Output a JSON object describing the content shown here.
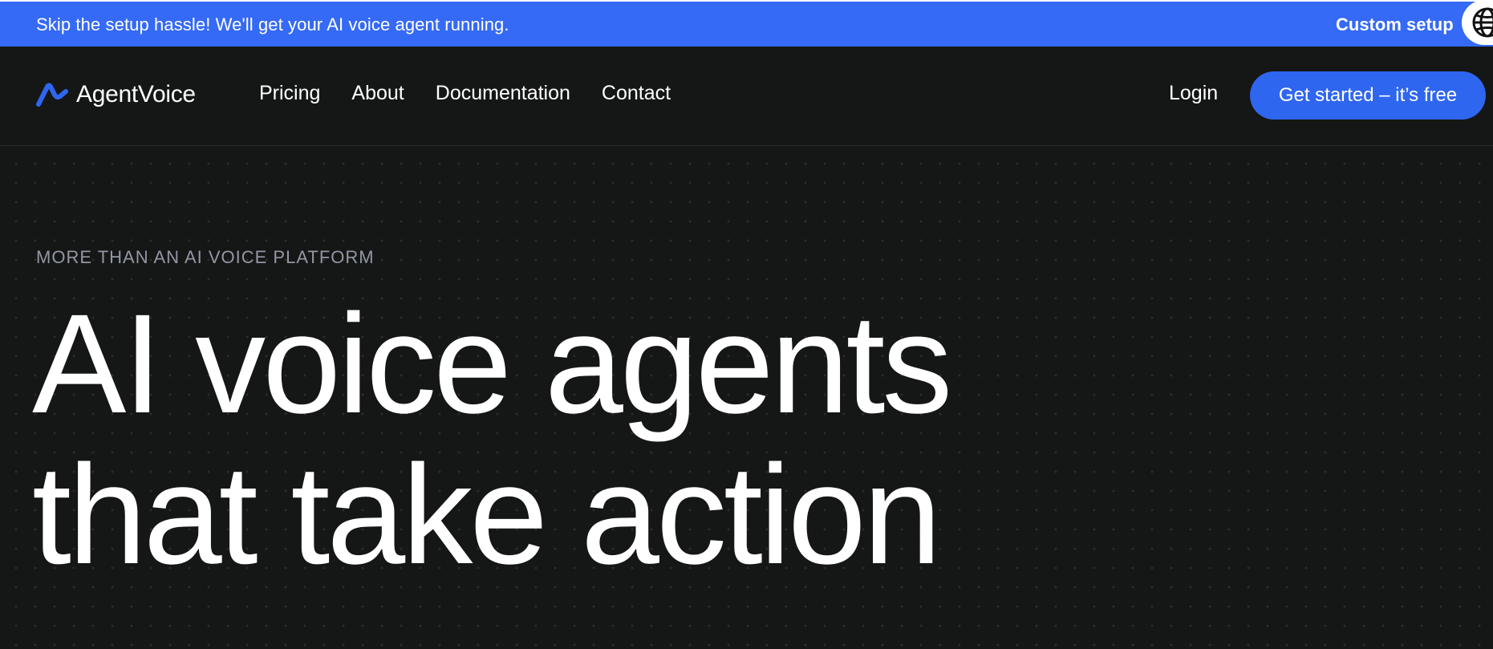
{
  "announcement": {
    "text": "Skip the setup hassle! We'll get your AI voice agent running.",
    "link_label": "Custom setup",
    "background_color": "#356af6",
    "badge_icon": "globe-icon"
  },
  "brand": {
    "name": "AgentVoice",
    "logo_icon": "wave-logo-icon",
    "accent_color": "#2f66f0"
  },
  "nav": {
    "links": [
      "Pricing",
      "About",
      "Documentation",
      "Contact"
    ],
    "login_label": "Login",
    "cta_label": "Get started – it’s free"
  },
  "hero": {
    "eyebrow": "MORE THAN AN AI VOICE PLATFORM",
    "headline_line1": "AI voice agents",
    "headline_line2": "that take action",
    "background_color": "#151716"
  }
}
